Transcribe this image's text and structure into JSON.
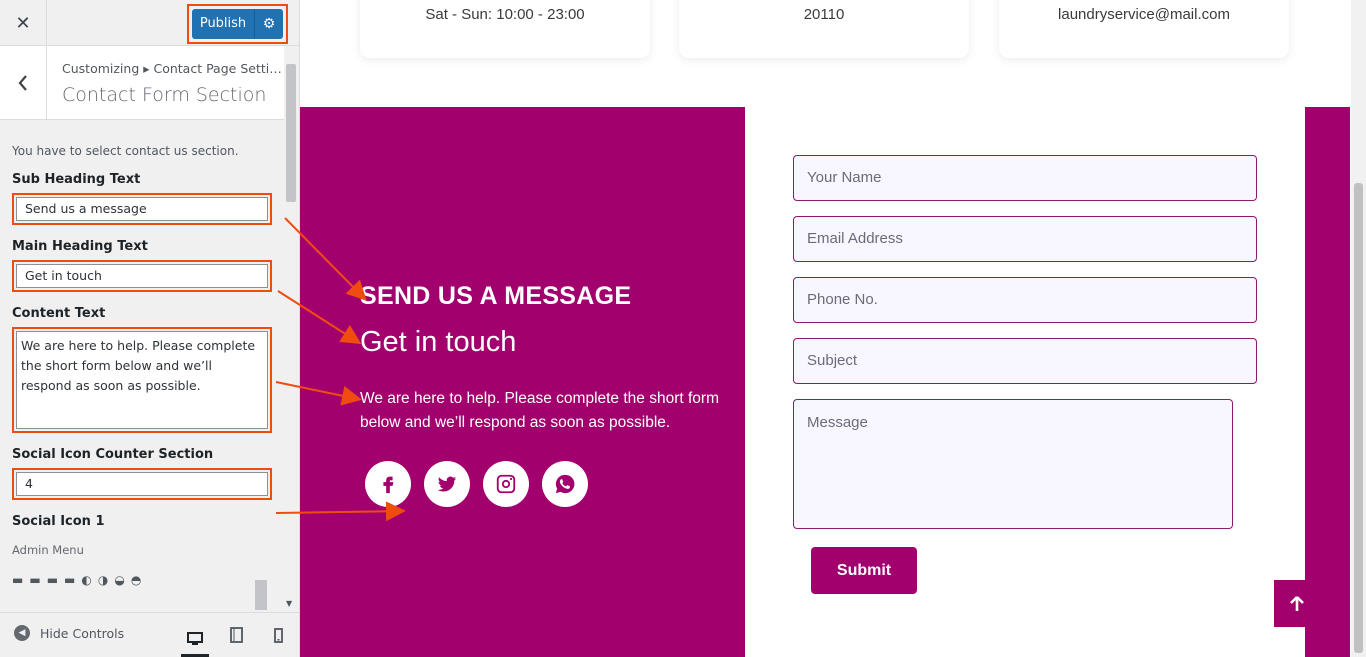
{
  "customizer": {
    "close_label": "✕",
    "publish_label": "Publish",
    "breadcrumb": "Customizing ▸ Contact Page Setti…",
    "section_title": "Contact Form Section",
    "description": "You have to select contact us section.",
    "sub_heading_label": "Sub Heading Text",
    "sub_heading_value": "Send us a message",
    "main_heading_label": "Main Heading Text",
    "main_heading_value": "Get in touch",
    "content_label": "Content Text",
    "content_value": "We are here to help. Please complete the short form below and we’ll respond as soon as possible.",
    "social_counter_label": "Social Icon Counter Section",
    "social_counter_value": "4",
    "social_icon_1_label": "Social Icon 1",
    "admin_menu_label": "Admin Menu",
    "hide_controls_label": "Hide Controls"
  },
  "preview": {
    "cards": [
      {
        "text": "Sat - Sun: 10:00 - 23:00"
      },
      {
        "text": "20110"
      },
      {
        "text": "laundryservice@mail.com"
      }
    ],
    "sub_heading": "SEND US A MESSAGE",
    "main_heading": "Get in touch",
    "content": "We are here to help. Please complete the short form below and we’ll respond as soon as possible.",
    "socials": [
      "facebook-icon",
      "twitter-icon",
      "instagram-icon",
      "whatsapp-icon"
    ],
    "form": {
      "name_placeholder": "Your Name",
      "email_placeholder": "Email Address",
      "phone_placeholder": "Phone No.",
      "subject_placeholder": "Subject",
      "message_placeholder": "Message",
      "submit_label": "Submit"
    }
  },
  "colors": {
    "brand": "#a2006d",
    "highlight": "#f14c10",
    "publish": "#2271b1"
  }
}
